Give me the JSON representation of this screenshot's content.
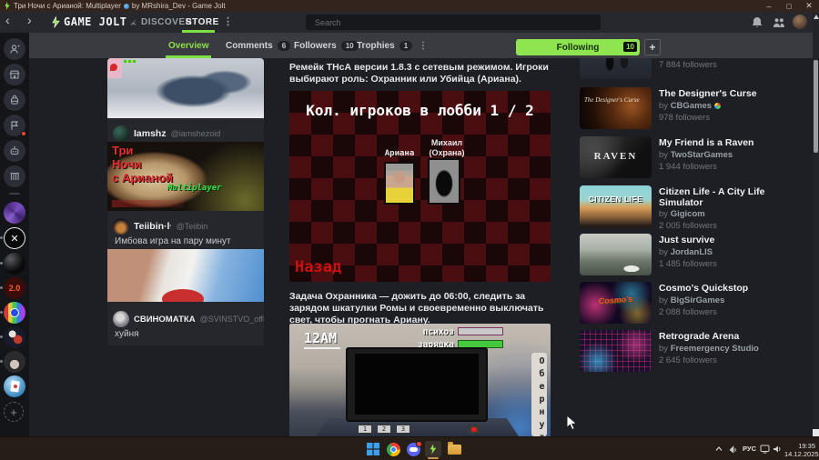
{
  "window": {
    "title_game": "Три Ночи с Арианой: Multiplayer",
    "title_rest": "by MRshira_Dev - Game Jolt",
    "minimize": "–",
    "maximize": "▢",
    "close": "✕"
  },
  "navbar": {
    "back": "‹",
    "forward": "›",
    "logo_text": "GAME JOLT",
    "discover": "DISCOVER",
    "store": "STORE",
    "search_placeholder": "Search"
  },
  "tabs": {
    "overview": "Overview",
    "comments": "Comments",
    "comments_count": "6",
    "followers": "Followers",
    "followers_count": "10",
    "trophies": "Trophies",
    "trophies_count": "1",
    "following_label": "Following",
    "following_count": "10",
    "add_label": "+"
  },
  "feed": {
    "posts": [
      {
        "user": "Iamshz",
        "handle": "@iamshezoid"
      },
      {
        "user": "Teiibin·ŀ",
        "handle": "@Teiibin",
        "text": "Имбова игра на пару минут"
      },
      {
        "user": "СВИНОМАТКА",
        "handle": "@SVINSTVO_official",
        "text": "хуйня"
      }
    ],
    "logo_image": {
      "line1": "Три",
      "line2": "Ночи",
      "line3": "с Арианой",
      "multiplayer": "Multiplayer"
    }
  },
  "description": {
    "p1": "Ремейк ТНсА версии 1.8.3 с сетевым режимом. Игроки выбирают роль: Охранник или Убийца (Ариана).",
    "p2": "Задача Охранника — дожить до 06:00, следить за зарядом шкатулки Ромы и своевременно выключать свет, чтобы прогнать Ариану."
  },
  "lobby_screenshot": {
    "title": "Кол. игроков в лобби 1 / 2",
    "player1": "Ариана",
    "player2_line1": "Михаил",
    "player2_line2": "(Охрана)",
    "back": "Назад"
  },
  "gameplay_screenshot": {
    "time": "12AM",
    "psycho_label": "психоз",
    "charge_label": "зарядка",
    "turn_text": "Обернут",
    "key1": "1",
    "key2": "2",
    "key3": "3"
  },
  "common": {
    "by": "by"
  },
  "sidebar_games": [
    {
      "followers": "7 884 followers"
    },
    {
      "title": "The Designer's Curse",
      "author": "CBGames",
      "followers": "978 followers",
      "thumb_text": "The Designer's Curse"
    },
    {
      "title": "My Friend is a Raven",
      "author": "TwoStarGames",
      "followers": "1 944 followers",
      "thumb_text": "RAVEN"
    },
    {
      "title": "Citizen Life - A City Life Simulator",
      "author": "Gigicom",
      "followers": "2 005 followers",
      "thumb_text": "CITIZEN LIFE"
    },
    {
      "title": "Just survive",
      "author": "JordanLIS",
      "followers": "1 485 followers"
    },
    {
      "title": "Cosmo's Quickstop",
      "author": "BigSirGames",
      "followers": "2 088 followers",
      "thumb_text": "Cosmo's"
    },
    {
      "title": "Retrograde Arena",
      "author": "Freemergency Studio",
      "followers": "2 645 followers"
    }
  ],
  "taskbar": {
    "lang": "РУС",
    "time": "19:35",
    "date": "14.12.2025"
  },
  "colors": {
    "accent_green": "#8ee550",
    "checker_red": "#4a0e11",
    "back_red": "#cc1111"
  }
}
